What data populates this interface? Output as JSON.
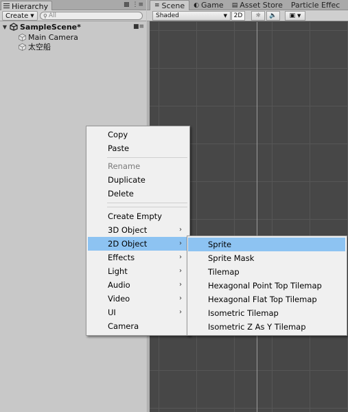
{
  "hierarchy": {
    "tab_label": "Hierarchy",
    "create_label": "Create",
    "search_placeholder": "All",
    "scene_name": "SampleScene*",
    "items": [
      {
        "label": "Main Camera"
      },
      {
        "label": "太空船"
      }
    ]
  },
  "scene_view": {
    "tabs": [
      {
        "label": "Scene",
        "icon": "hash-icon"
      },
      {
        "label": "Game",
        "icon": "pacman-icon"
      },
      {
        "label": "Asset Store",
        "icon": "bag-icon"
      },
      {
        "label": "Particle Effec",
        "icon": ""
      }
    ],
    "shading_mode": "Shaded",
    "mode_2d_label": "2D"
  },
  "context_menu": {
    "items": [
      {
        "label": "Copy",
        "enabled": true,
        "submenu": false
      },
      {
        "label": "Paste",
        "enabled": true,
        "submenu": false
      },
      {
        "label": "Rename",
        "enabled": false,
        "submenu": false
      },
      {
        "label": "Duplicate",
        "enabled": true,
        "submenu": false
      },
      {
        "label": "Delete",
        "enabled": true,
        "submenu": false
      },
      {
        "label": "Create Empty",
        "enabled": true,
        "submenu": false
      },
      {
        "label": "3D Object",
        "enabled": true,
        "submenu": true
      },
      {
        "label": "2D Object",
        "enabled": true,
        "submenu": true,
        "highlighted": true
      },
      {
        "label": "Effects",
        "enabled": true,
        "submenu": true
      },
      {
        "label": "Light",
        "enabled": true,
        "submenu": true
      },
      {
        "label": "Audio",
        "enabled": true,
        "submenu": true
      },
      {
        "label": "Video",
        "enabled": true,
        "submenu": true
      },
      {
        "label": "UI",
        "enabled": true,
        "submenu": true
      },
      {
        "label": "Camera",
        "enabled": true,
        "submenu": false
      }
    ]
  },
  "submenu_2d": {
    "items": [
      {
        "label": "Sprite",
        "highlighted": true
      },
      {
        "label": "Sprite Mask"
      },
      {
        "label": "Tilemap"
      },
      {
        "label": "Hexagonal Point Top Tilemap"
      },
      {
        "label": "Hexagonal Flat Top Tilemap"
      },
      {
        "label": "Isometric Tilemap"
      },
      {
        "label": "Isometric Z As Y Tilemap"
      }
    ]
  },
  "colors": {
    "highlight": "#8dc3f2",
    "scene_background": "#474747",
    "panel_background": "#c8c8c8"
  }
}
